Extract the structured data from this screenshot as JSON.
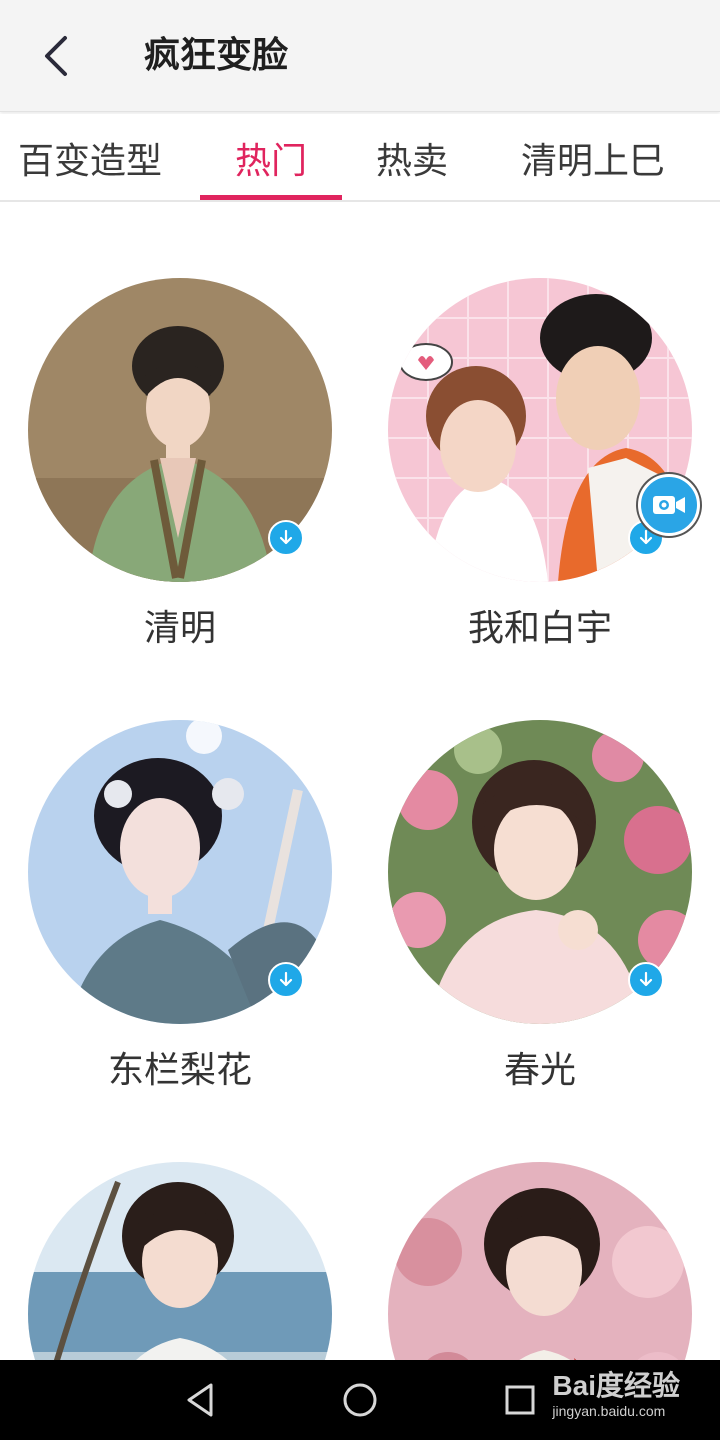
{
  "header": {
    "title": "疯狂变脸",
    "back_icon": "chevron-left-icon"
  },
  "tabs": [
    {
      "label": "百变造型",
      "active": false
    },
    {
      "label": "热门",
      "active": true
    },
    {
      "label": "热卖",
      "active": false
    },
    {
      "label": "清明上巳",
      "active": false
    }
  ],
  "cards": [
    {
      "label": "清明",
      "badge": "download-icon"
    },
    {
      "label": "我和白宇",
      "badge": "download-icon",
      "extra_badge": "video-icon"
    },
    {
      "label": "东栏梨花",
      "badge": "download-icon"
    },
    {
      "label": "春光",
      "badge": "download-icon"
    },
    {
      "label": "",
      "badge": ""
    },
    {
      "label": "",
      "badge": ""
    }
  ],
  "navbar": {
    "back_icon": "triangle-back-icon",
    "home_icon": "circle-home-icon",
    "recent_icon": "square-recent-icon"
  },
  "watermark": {
    "main": "Bai度经验",
    "sub": "jingyan.baidu.com"
  },
  "colors": {
    "accent": "#e0245e",
    "badge": "#1fa8e8",
    "header_bg": "#f4f4f4"
  }
}
